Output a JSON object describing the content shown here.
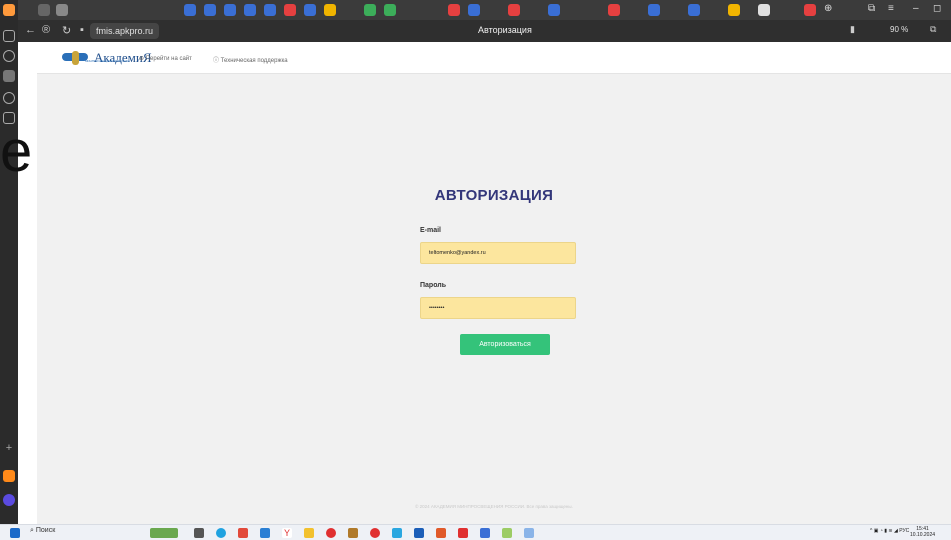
{
  "overlay": {
    "glyph": "e"
  },
  "browser": {
    "url": "fmis.apkpro.ru",
    "tab_title": "Авторизация",
    "zoom": "90 %"
  },
  "site": {
    "logo_text": "АкадемиЯ",
    "logo_subtitle": "МИНПРОСВЕЩЕНИЯ РОССИИ",
    "nav": [
      {
        "label": "Перейти на сайт"
      },
      {
        "label": "Техническая поддержка"
      }
    ]
  },
  "auth": {
    "title": "АВТОРИЗАЦИЯ",
    "email_label": "E-mail",
    "email_value": "teltomenko@yandex.ru",
    "password_label": "Пароль",
    "password_value": "••••••••",
    "submit_label": "Авторизоваться"
  },
  "footer": {
    "text": "© 2024 АКАДЕМИЯ МИНПРОСВЕЩЕНИЯ РОССИИ. Все права защищены."
  },
  "taskbar": {
    "search_label": "Поиск",
    "language": "РУС",
    "time": "15:41",
    "date": "10.10.2024"
  },
  "colors": {
    "title": "#33367a",
    "field_bg": "#fce69e",
    "button_bg": "#34c37a",
    "logo_blue": "#1f4e8c"
  }
}
